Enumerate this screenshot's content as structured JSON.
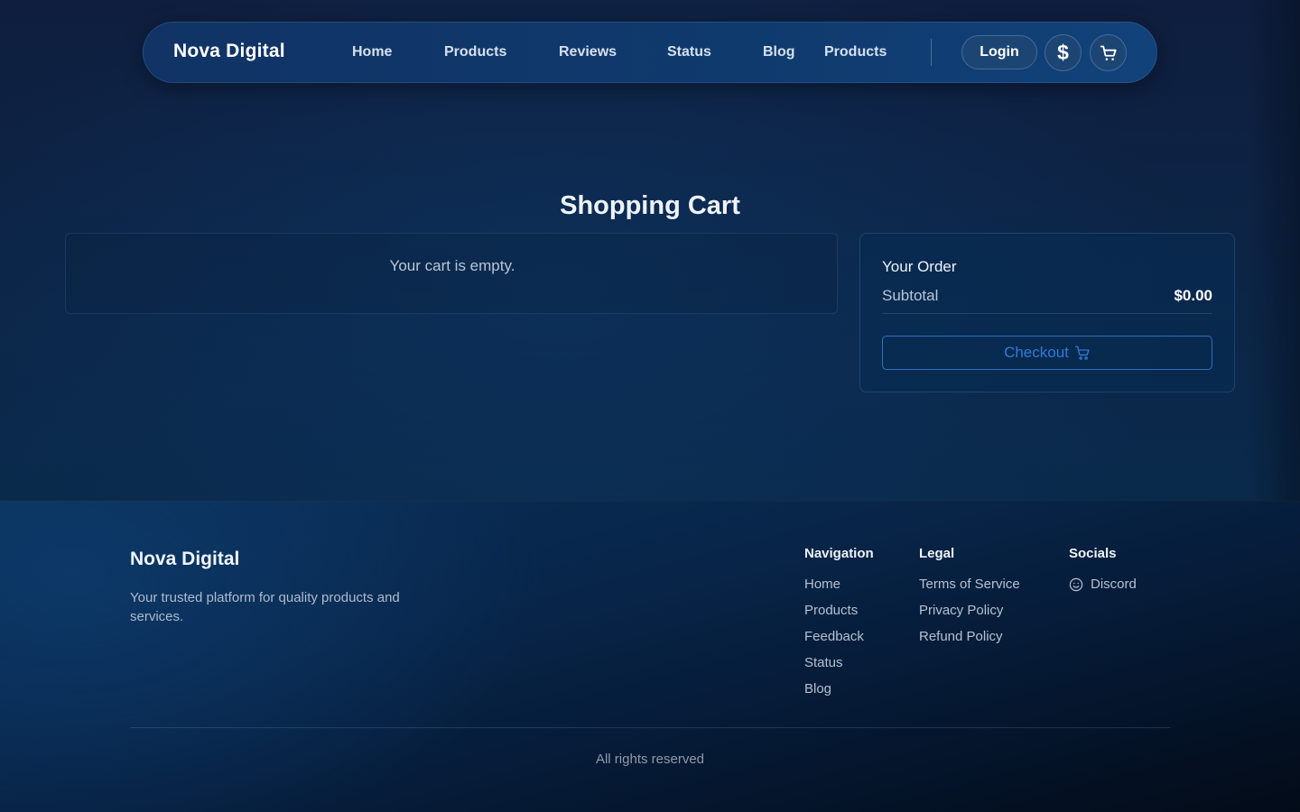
{
  "nav": {
    "brand": "Nova Digital",
    "links": [
      "Home",
      "Products",
      "Reviews",
      "Status",
      "Blog",
      "Products"
    ],
    "login_label": "Login",
    "currency_icon": "dollar-icon",
    "cart_icon": "cart-icon"
  },
  "cart": {
    "title": "Shopping Cart",
    "empty_message": "Your cart is empty."
  },
  "order": {
    "title": "Your Order",
    "subtotal_label": "Subtotal",
    "subtotal_value": "$0.00",
    "checkout_label": "Checkout"
  },
  "footer": {
    "brand": "Nova Digital",
    "tagline": "Your trusted platform for quality products and services.",
    "navigation": {
      "title": "Navigation",
      "links": [
        "Home",
        "Products",
        "Feedback",
        "Status",
        "Blog"
      ]
    },
    "legal": {
      "title": "Legal",
      "links": [
        "Terms of Service",
        "Privacy Policy",
        "Refund Policy"
      ]
    },
    "socials": {
      "title": "Socials",
      "links": [
        "Discord"
      ]
    },
    "copyright": "All rights reserved"
  },
  "colors": {
    "accent": "#2f7bd6",
    "background": "#0c2547"
  }
}
